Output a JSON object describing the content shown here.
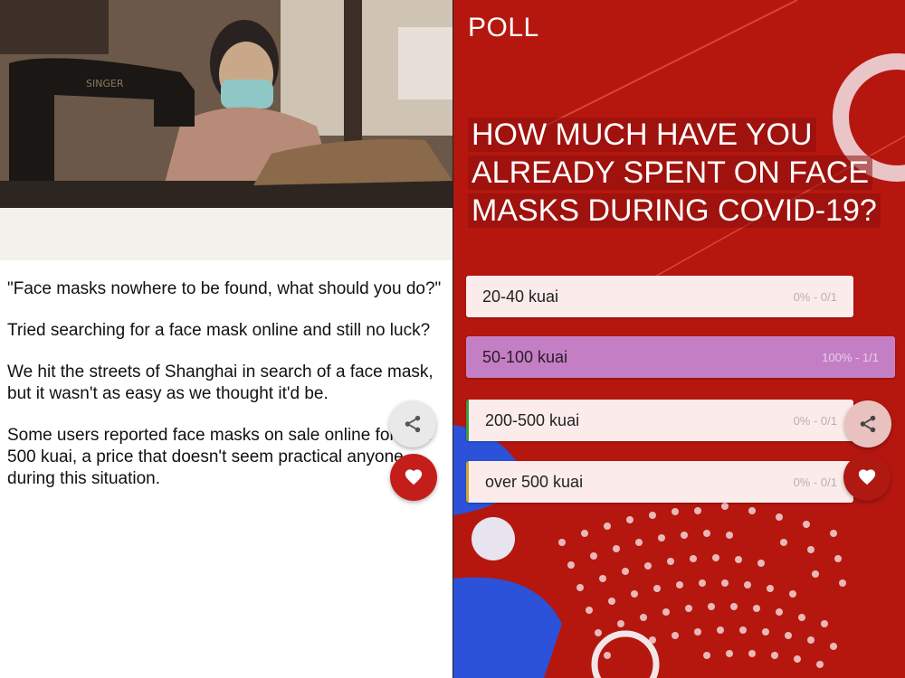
{
  "article": {
    "paragraphs": [
      "\"Face masks nowhere to be found, what should you do?\"",
      "Tried searching for a face mask online and still no luck?",
      "We hit the streets of Shanghai in search of a face mask, but it wasn't as easy as we thought it'd be.",
      "Some users reported face masks on sale online for over 500 kuai, a price that doesn't seem practical anyone during this situation."
    ],
    "photo_sign": "SINGER"
  },
  "actions": {
    "share_icon": "share-icon",
    "like_icon": "heart-icon"
  },
  "poll": {
    "label": "POLL",
    "question": "HOW MUCH HAVE YOU ALREADY SPENT ON FACE MASKS DURING COVID-19?",
    "options": [
      {
        "label": "20-40 kuai",
        "stat": "0% - 0/1",
        "percent": 0
      },
      {
        "label": "50-100 kuai",
        "stat": "100% - 1/1",
        "percent": 100
      },
      {
        "label": "200-500 kuai",
        "stat": "0% - 0/1",
        "percent": 0
      },
      {
        "label": "over 500 kuai",
        "stat": "0% - 0/1",
        "percent": 0
      }
    ]
  },
  "colors": {
    "poll_background": "#b5170f",
    "selected_option": "#c47fc4",
    "option_background": "#fbeceb",
    "heart_button": "#c41e1a"
  }
}
